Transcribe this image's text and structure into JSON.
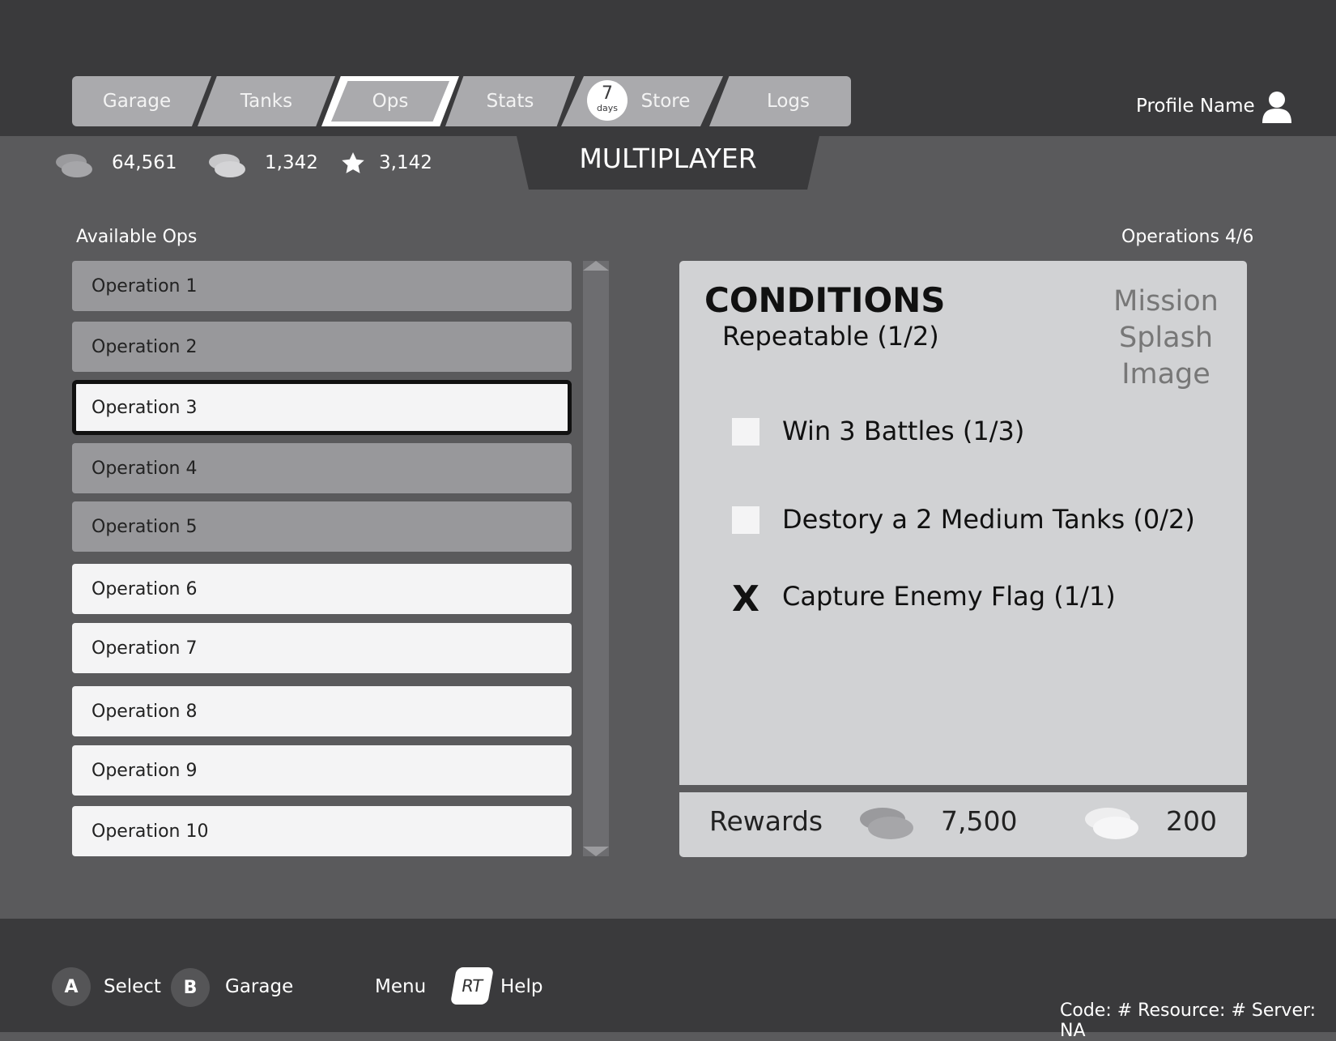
{
  "tabs": [
    {
      "label": "Garage"
    },
    {
      "label": "Tanks"
    },
    {
      "label": "Ops"
    },
    {
      "label": "Stats"
    },
    {
      "label": "Store",
      "badge_number": "7",
      "badge_label": "days"
    },
    {
      "label": "Logs"
    }
  ],
  "active_tab": "Ops",
  "profile": {
    "name": "Profile Name"
  },
  "currency": {
    "credits": "64,561",
    "gold": "1,342",
    "stars": "3,142"
  },
  "mode_title": "MULTIPLAYER",
  "available_ops_label": "Available Ops",
  "operations_count_label": "Operations 4/6",
  "operations": [
    {
      "name": "Operation 1",
      "state": "locked"
    },
    {
      "name": "Operation 2",
      "state": "locked"
    },
    {
      "name": "Operation 3",
      "state": "selected"
    },
    {
      "name": "Operation 4",
      "state": "locked"
    },
    {
      "name": "Operation 5",
      "state": "locked"
    },
    {
      "name": "Operation 6",
      "state": "available"
    },
    {
      "name": "Operation 7",
      "state": "available"
    },
    {
      "name": "Operation 8",
      "state": "available"
    },
    {
      "name": "Operation 9",
      "state": "available"
    },
    {
      "name": "Operation 10",
      "state": "available"
    }
  ],
  "conditions": {
    "title": "CONDITIONS",
    "subtitle": "Repeatable (1/2)",
    "splash_lines": [
      "Mission",
      "Splash",
      "Image"
    ],
    "items": [
      {
        "text": "Win 3 Battles (1/3)",
        "complete": false
      },
      {
        "text": "Destory a 2 Medium Tanks (0/2)",
        "complete": false
      },
      {
        "text": "Capture Enemy Flag (1/1)",
        "complete": true,
        "mark": "X"
      }
    ]
  },
  "rewards": {
    "label": "Rewards",
    "credits": "7,500",
    "gold": "200"
  },
  "controls": {
    "a_key": "A",
    "a_label": "Select",
    "b_key": "B",
    "b_label": "Garage",
    "menu_label": "Menu",
    "rt_key": "RT",
    "rt_label": "Help"
  },
  "footer_info": "Code: # Resource: # Server: NA",
  "colors": {
    "top_bar": "#3a3a3c",
    "background": "#5a5a5c",
    "tab": "#aaaaad",
    "panel": "#d1d2d4",
    "selected_border": "#111111"
  }
}
